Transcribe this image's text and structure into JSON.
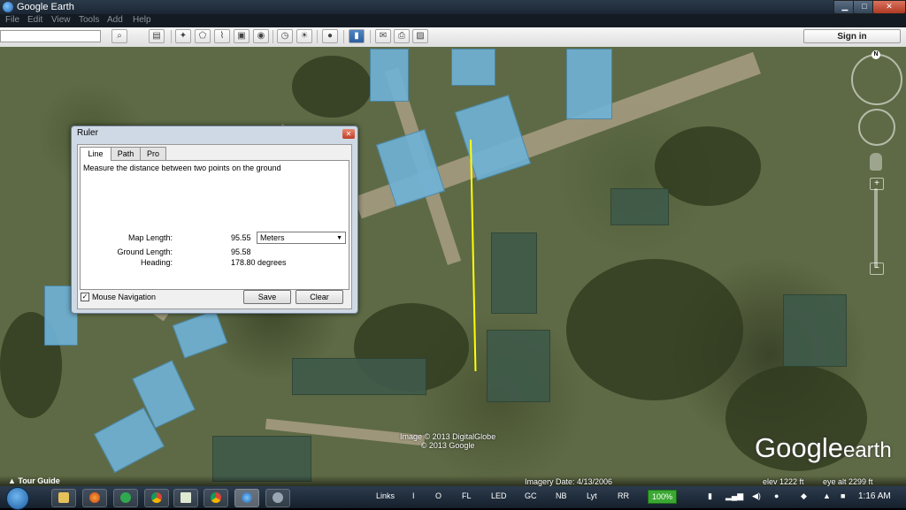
{
  "window": {
    "title": "Google Earth",
    "minimize": "▁",
    "maximize": "□",
    "close": "✕"
  },
  "menu": [
    "File",
    "Edit",
    "View",
    "Tools",
    "Add",
    "Help"
  ],
  "toolbar": {
    "search_value": "",
    "signin_label": "Sign in"
  },
  "ruler": {
    "title": "Ruler",
    "close": "✕",
    "tabs": [
      "Line",
      "Path",
      "Pro"
    ],
    "description": "Measure the distance between two points on the ground",
    "map_length_label": "Map Length:",
    "map_length_value": "95.55",
    "unit": "Meters",
    "ground_length_label": "Ground Length:",
    "ground_length_value": "95.58",
    "heading_label": "Heading:",
    "heading_value": "178.80 degrees",
    "mouse_nav_label": "Mouse Navigation",
    "mouse_nav_checked": true,
    "save_label": "Save",
    "clear_label": "Clear"
  },
  "map": {
    "copyright_line1": "Image © 2013 DigitalGlobe",
    "copyright_line2": "© 2013 Google",
    "logo_text": "Google",
    "logo_text2": "earth",
    "compass_north": "N"
  },
  "status": {
    "tour_guide": "Tour Guide",
    "imagery_date": "Imagery Date: 4/13/2006",
    "elev": "elev  1222 ft",
    "eye_alt": "eye alt  2299 ft"
  },
  "taskbar": {
    "links_label": "Links",
    "tray_items": [
      "I",
      "O",
      "FL",
      "LED",
      "GC",
      "NB",
      "Lyt",
      "RR"
    ],
    "battery": "100%",
    "clock": "1:16 AM"
  },
  "colors": {
    "ruler_line": "#ffff00",
    "battery": "#3aa832"
  }
}
